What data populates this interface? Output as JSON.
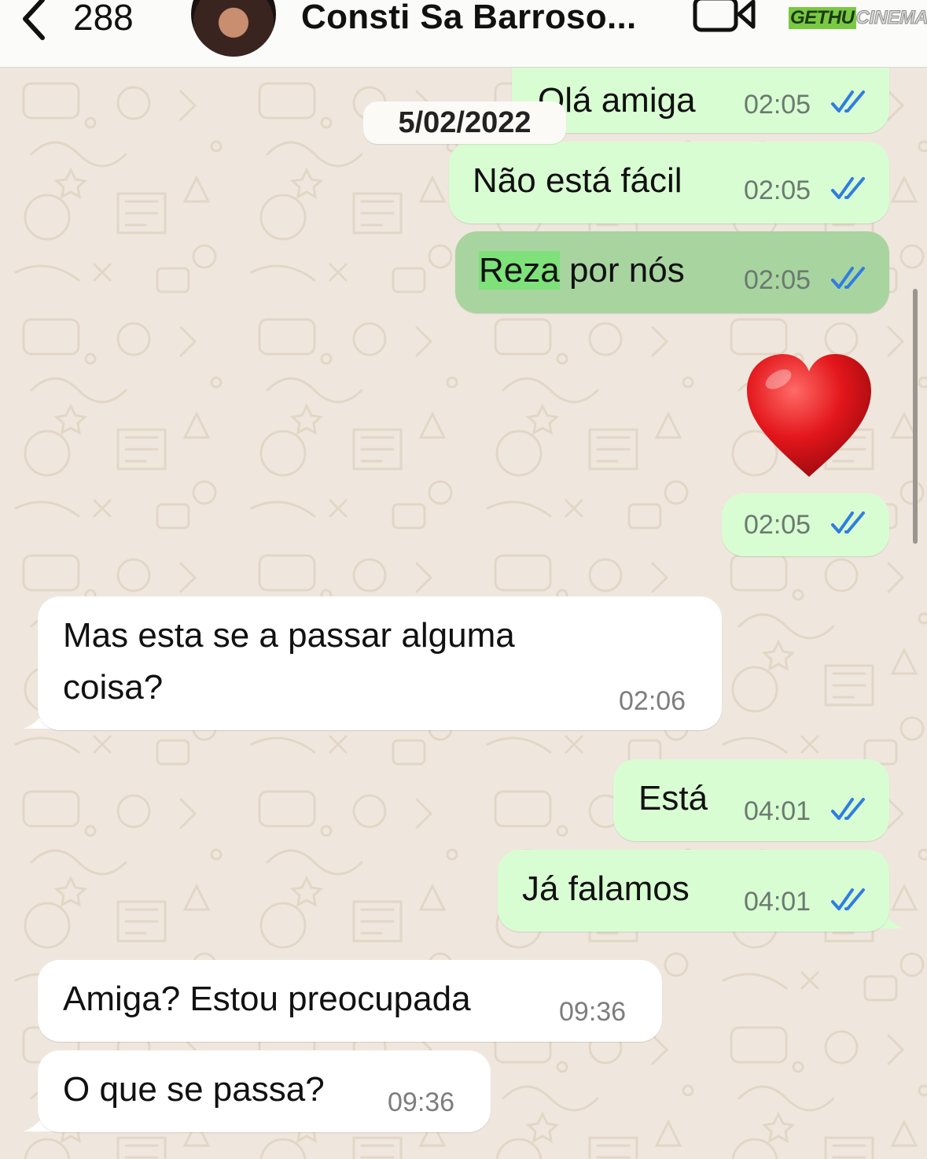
{
  "header": {
    "back_count": "288",
    "contact_name": "Consti Sa Barroso...",
    "watermark_a": "GETHU",
    "watermark_b": "CINEMA"
  },
  "chat": {
    "date_label": "5/02/2022",
    "messages": [
      {
        "text": "Olá amiga",
        "time": "02:05",
        "direction": "outgoing",
        "status": "read"
      },
      {
        "text": "Não está fácil",
        "time": "02:05",
        "direction": "outgoing",
        "status": "read"
      },
      {
        "text_highlight": "Reza",
        "text_rest": " por nós",
        "time": "02:05",
        "direction": "outgoing",
        "status": "read",
        "selected": true
      },
      {
        "emoji": "heart",
        "time": "02:05",
        "direction": "outgoing",
        "status": "read"
      },
      {
        "line1": "Mas esta se a passar alguma",
        "line2": "coisa?",
        "time": "02:06",
        "direction": "incoming"
      },
      {
        "text": "Está",
        "time": "04:01",
        "direction": "outgoing",
        "status": "read"
      },
      {
        "text": "Já falamos",
        "time": "04:01",
        "direction": "outgoing",
        "status": "read"
      },
      {
        "text": "Amiga? Estou preocupada",
        "time": "09:36",
        "direction": "incoming"
      },
      {
        "text": "O que se passa?",
        "time": "09:36",
        "direction": "incoming"
      }
    ]
  },
  "colors": {
    "outgoing_bubble": "#d9fdd3",
    "selected_bubble": "#a8d4a0",
    "incoming_bubble": "#ffffff",
    "read_ticks": "#2f7de1",
    "search_highlight": "#7ee17a",
    "wallpaper": "#efe7dd"
  }
}
